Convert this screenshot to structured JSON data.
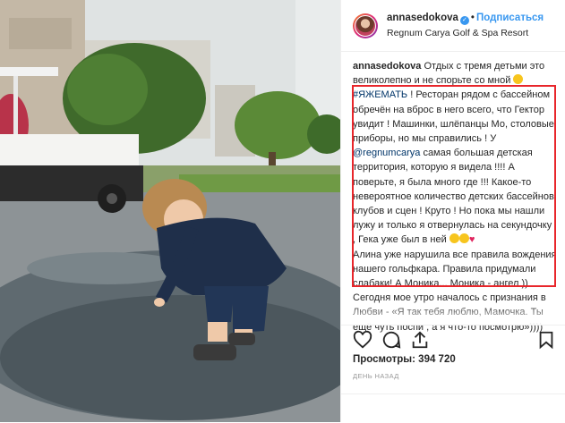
{
  "header": {
    "username": "annasedokova",
    "follow_label": "Подписаться",
    "location": "Regnum Carya Golf & Spa Resort"
  },
  "caption": {
    "username": "annasedokova",
    "intro": "Отдых с тремя детьми это великолепно и не спорьте со мной",
    "hashtag": "#ЯЖЕМАТЬ",
    "part1": "! Ресторан рядом с бассейном обречён на вброс в него всего, что Гектор увидит ! Машинки, шлёпанцы Мо, столовые приборы, но мы справились ! У",
    "mention": "@regnumcarya",
    "part2": "самая большая детская территория, которую я видела !!!! А поверьте, я была много где !!! Какое-то невероятное количество детских бассейнов, клубов и сцен ! Круто ! Но пока мы нашли лужу и только я отвернулась на секундочку , Гека уже был в ней",
    "part3": "Алина уже нарушила все правила вождения нашего гольфкара. Правила придумали слабаки! А Моника... Моника - ангел )) Сегодня мое утро началось с признания в Любви - «Я так тебя люблю, Мамочка. Ты ещё чуть поспи , а я что-то посмотрю»))))"
  },
  "icons": {
    "like": "heart-outline-icon",
    "comment": "comment-icon",
    "share": "share-icon",
    "save": "bookmark-icon",
    "verified": "verified-badge-icon"
  },
  "stats": {
    "views_label": "Просмотры:",
    "views_value": "394 720",
    "time": "ДЕНЬ НАЗАД"
  },
  "colors": {
    "accent": "#3897f0",
    "highlight_border": "#e8262b",
    "link": "#003569"
  }
}
